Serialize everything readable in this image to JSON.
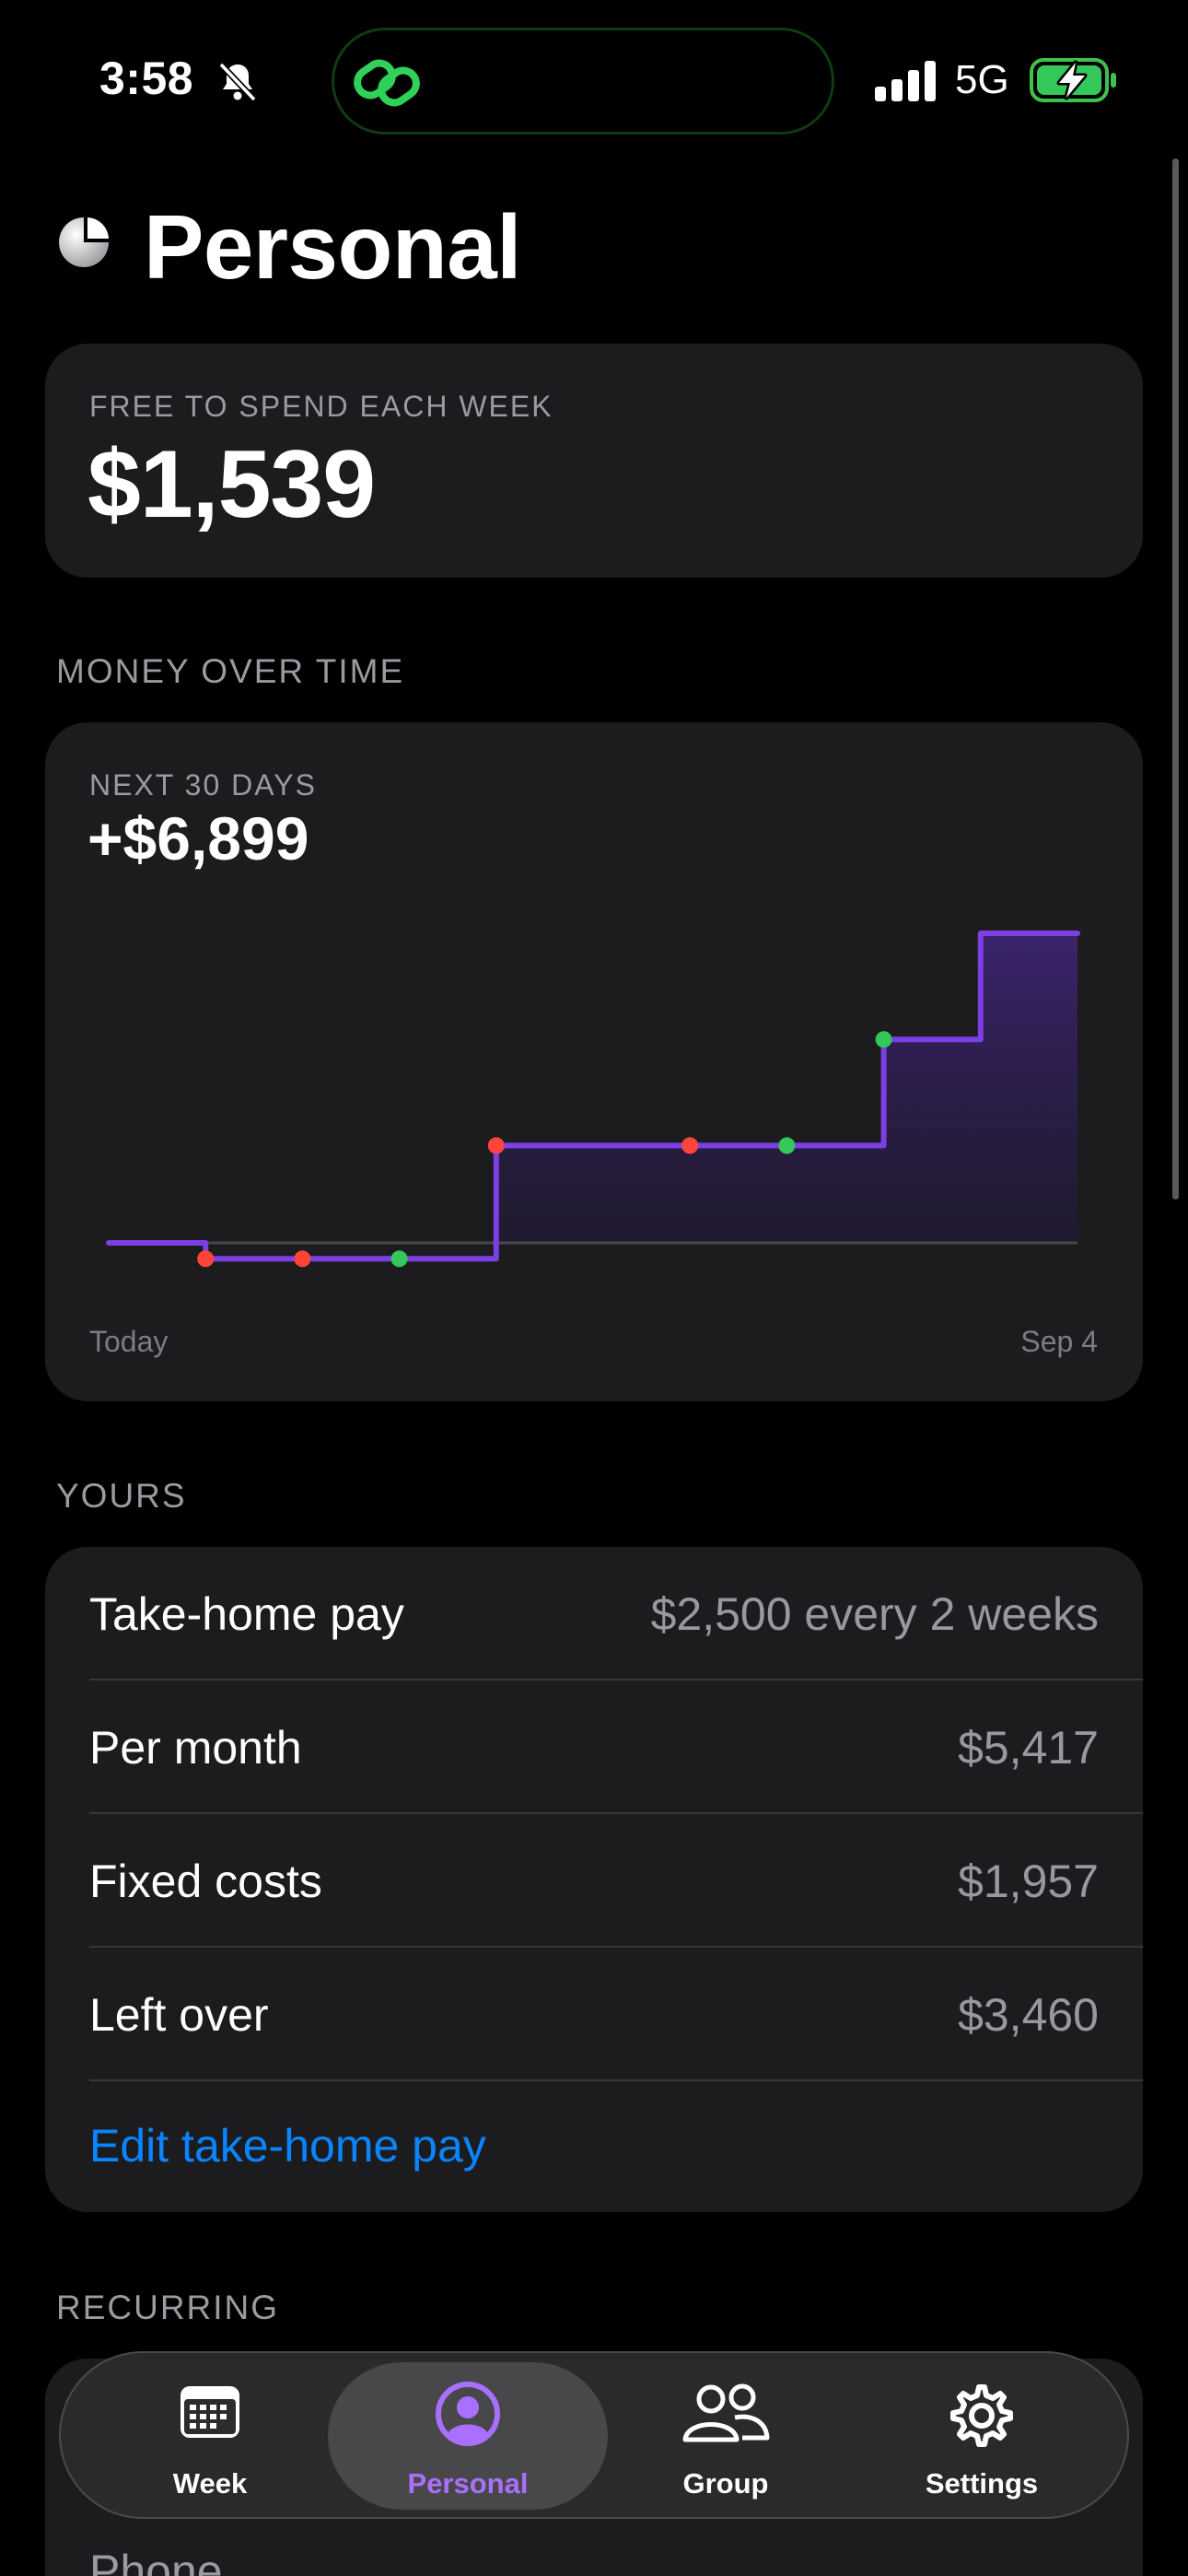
{
  "status_bar": {
    "time": "3:58",
    "network": "5G"
  },
  "header": {
    "title": "Personal"
  },
  "free_card": {
    "label": "FREE TO SPEND EACH WEEK",
    "amount": "$1,539"
  },
  "money_section": {
    "label": "MONEY OVER TIME"
  },
  "chart_card": {
    "label": "NEXT 30 DAYS",
    "amount": "+$6,899",
    "start_label": "Today",
    "end_label": "Sep 4"
  },
  "chart_data": {
    "type": "line",
    "step": true,
    "x": [
      "Today",
      "",
      "",
      "",
      "",
      "",
      "",
      "",
      "",
      "",
      "Sep 4"
    ],
    "series": [
      {
        "values": [
          0,
          -180,
          -180,
          -180,
          1100,
          1100,
          1100,
          1100,
          2300,
          3500,
          3500
        ],
        "color": "#7b3fe4"
      }
    ],
    "income_points": [
      3,
      7,
      8
    ],
    "expense_points": [
      1,
      2,
      4,
      6
    ],
    "colors": {
      "line": "#7b3fe4",
      "income": "#34c759",
      "expense": "#ff453a",
      "baseline": "#48484a"
    }
  },
  "yours_section": {
    "label": "YOURS",
    "rows": [
      {
        "label": "Take-home pay",
        "value": "$2,500 every 2 weeks"
      },
      {
        "label": "Per month",
        "value": "$5,417"
      },
      {
        "label": "Fixed costs",
        "value": "$1,957"
      },
      {
        "label": "Left over",
        "value": "$3,460"
      }
    ],
    "edit_label": "Edit take-home pay"
  },
  "recurring_section": {
    "label": "RECURRING",
    "next_item": "Phone"
  },
  "tab_bar": {
    "tabs": [
      {
        "label": "Week",
        "icon": "calendar-icon"
      },
      {
        "label": "Personal",
        "icon": "person-icon",
        "active": true
      },
      {
        "label": "Group",
        "icon": "group-icon"
      },
      {
        "label": "Settings",
        "icon": "gear-icon"
      }
    ],
    "active_color": "#a970ff"
  }
}
